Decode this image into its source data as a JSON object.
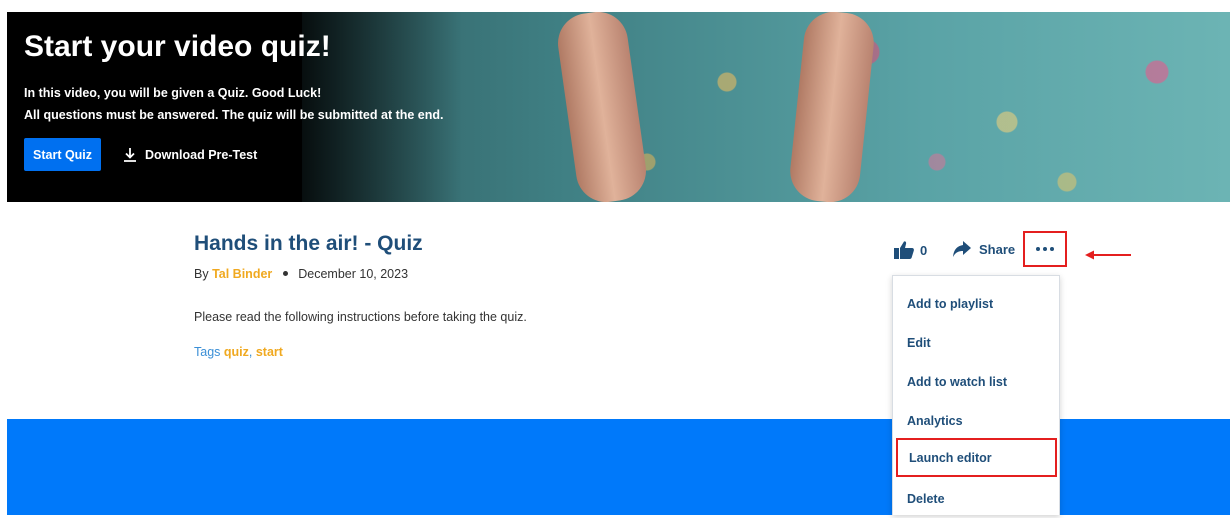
{
  "hero": {
    "title": "Start your video quiz!",
    "line1": "In this video, you will be given a Quiz. Good Luck!",
    "line2": "All questions must be answered. The quiz will be submitted at the end.",
    "start_label": "Start Quiz",
    "download_label": "Download Pre-Test",
    "accent_color": "#0070f0"
  },
  "entry": {
    "title": "Hands in the air! - Quiz",
    "by_prefix": "By",
    "author": "Tal Binder",
    "date": "December 10, 2023",
    "description": "Please read the following instructions before taking the quiz.",
    "tags_label": "Tags",
    "tags": [
      "quiz",
      "start"
    ]
  },
  "actions": {
    "like_count": "0",
    "share_label": "Share",
    "more_icon": "ellipsis-icon"
  },
  "menu": {
    "items": [
      "Add to playlist",
      "Edit",
      "Add to watch list",
      "Analytics",
      "Launch editor",
      "Delete"
    ],
    "highlighted_index": 4
  },
  "colors": {
    "title": "#1f4e79",
    "author": "#f0a920",
    "highlight_border": "#e41f1f",
    "band": "#0079fa"
  }
}
